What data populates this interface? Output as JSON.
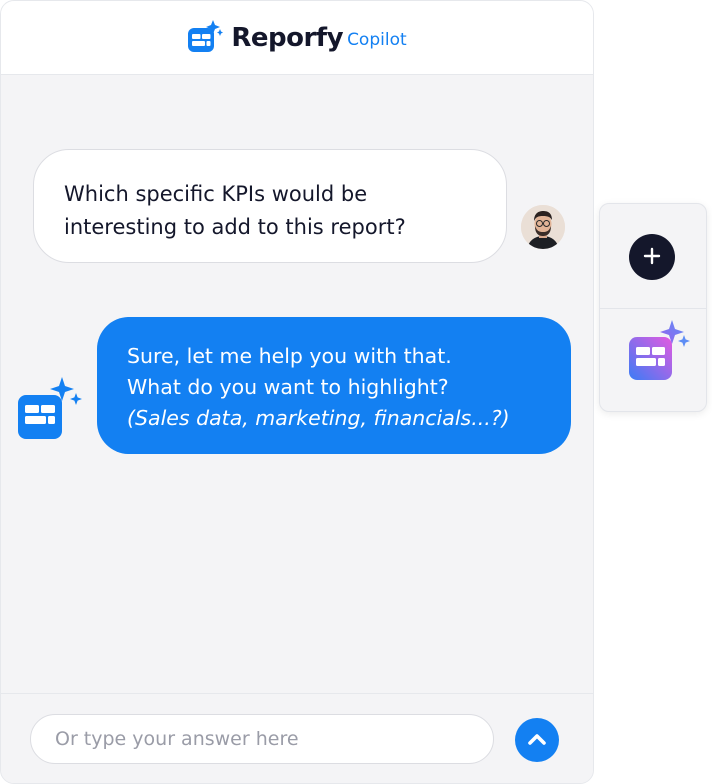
{
  "header": {
    "brand_name": "Reporfy",
    "brand_sub": "Copilot"
  },
  "conversation": {
    "user_message": "Which specific KPIs would be interesting to add to this report?",
    "bot_message_line1": "Sure, let me help you with that.",
    "bot_message_line2": "What do you want to highlight?",
    "bot_message_line3": "(Sales data, marketing, financials...?)"
  },
  "composer": {
    "placeholder": "Or type your answer here",
    "value": ""
  },
  "icons": {
    "brand": "reporfy-logo-icon",
    "user_avatar": "user-avatar",
    "bot_avatar": "copilot-bot-icon",
    "send": "chevron-up-icon",
    "add": "plus-icon",
    "side_copilot": "copilot-gradient-icon"
  },
  "colors": {
    "accent": "#1380f2",
    "dark": "#14172b",
    "gradient_start": "#3b7cf5",
    "gradient_end": "#e45ae0"
  }
}
